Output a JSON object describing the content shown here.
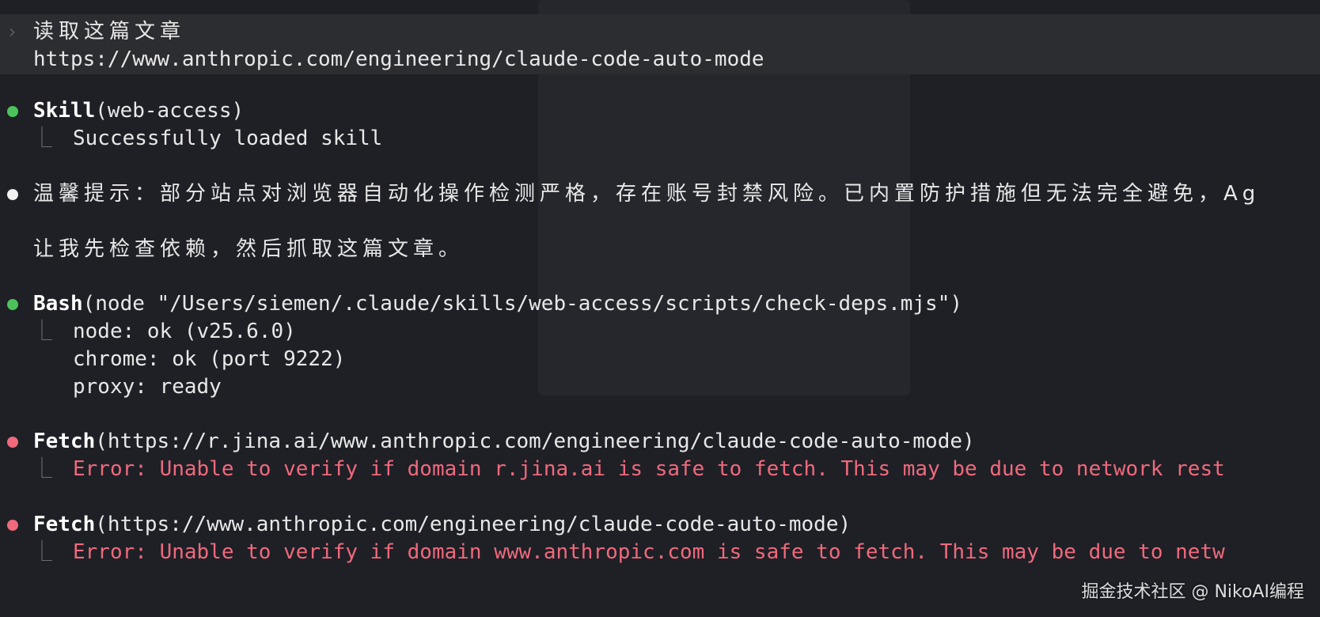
{
  "prompt": {
    "chevron": "›",
    "line1": "读取这篇文章",
    "line2": "https://www.anthropic.com/engineering/claude-code-auto-mode"
  },
  "skill": {
    "name": "Skill",
    "args": "(web-access)",
    "result": "Successfully loaded skill",
    "status_color": "#4cc25b"
  },
  "notice": {
    "text": "温馨提示：部分站点对浏览器自动化操作检测严格，存在账号封禁风险。已内置防护措施但无法完全避免，Ag"
  },
  "message": {
    "text": "让我先检查依赖，然后抓取这篇文章。"
  },
  "bash": {
    "name": "Bash",
    "args": "(node \"/Users/siemen/.claude/skills/web-access/scripts/check-deps.mjs\")",
    "output": [
      "node: ok (v25.6.0)",
      "chrome: ok (port 9222)",
      "proxy: ready"
    ],
    "status_color": "#4cc25b"
  },
  "fetch1": {
    "name": "Fetch",
    "args": "(https://r.jina.ai/www.anthropic.com/engineering/claude-code-auto-mode)",
    "error": "Error: Unable to verify if domain r.jina.ai is safe to fetch. This may be due to network rest",
    "status_color": "#f0697c"
  },
  "fetch2": {
    "name": "Fetch",
    "args": "(https://www.anthropic.com/engineering/claude-code-auto-mode)",
    "error": "Error: Unable to verify if domain www.anthropic.com is safe to fetch. This may be due to netw",
    "status_color": "#f0697c"
  },
  "tree_glyph": "⎿",
  "watermark": "掘金技术社区 @ NikoAI编程"
}
